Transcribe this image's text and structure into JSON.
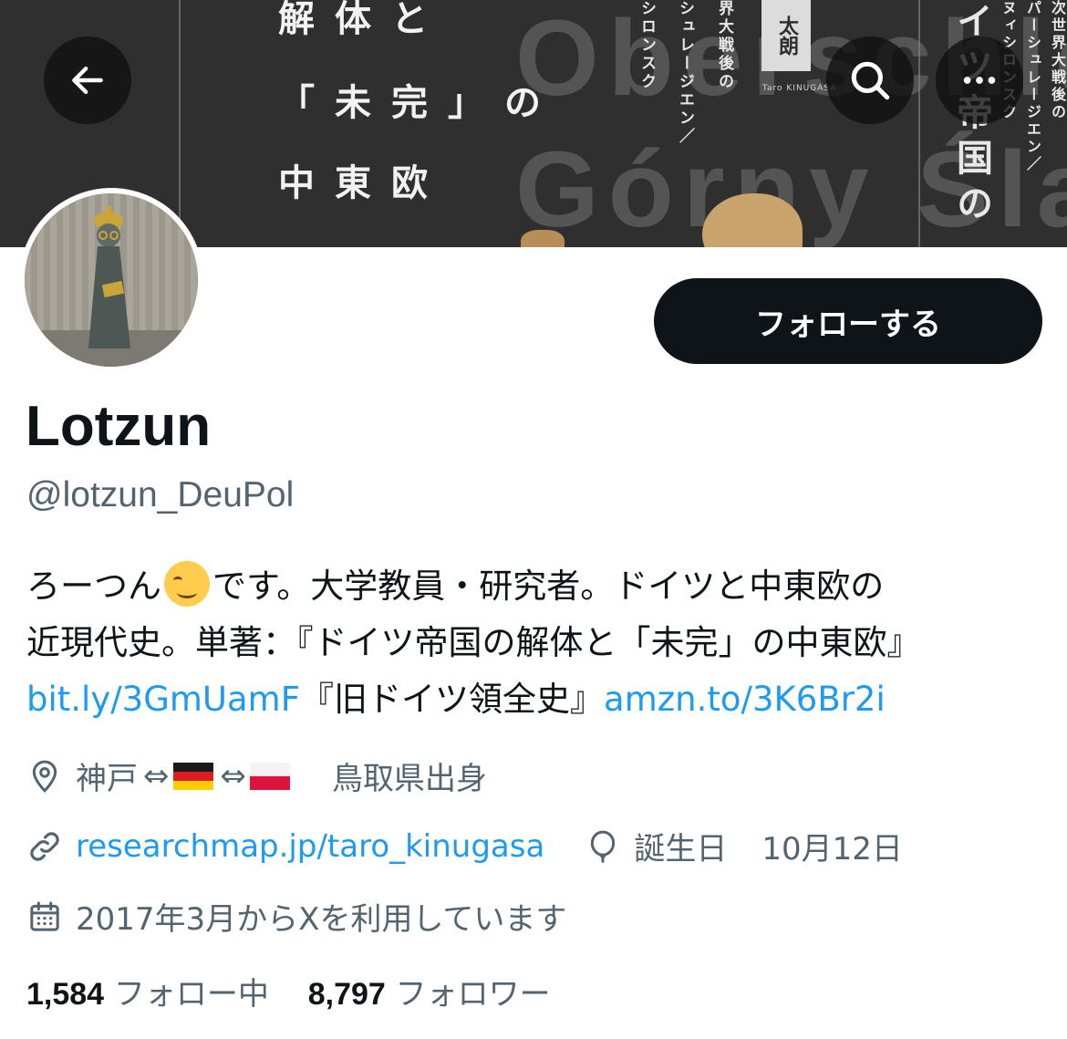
{
  "banner": {
    "title_lines": [
      "解体と",
      "「未完」の",
      "中東欧"
    ],
    "vertical_left": [
      "界大戦後の",
      "シュレージエン／",
      "シロンスク"
    ],
    "author_name": "太朗",
    "author_latin": "Taro KINUGASA",
    "vertical_right_title": [
      "イツ帝国の"
    ],
    "vertical_far_right": [
      "次世界大戦後の",
      "パーシュレージエン／",
      "ヌィシロンスク"
    ],
    "ghost_text": [
      "Oberschles",
      "Górny Śląs"
    ]
  },
  "header": {
    "back_icon": "arrow-left-icon",
    "search_icon": "search-icon",
    "more_icon": "more-horizontal-icon"
  },
  "profile": {
    "display_name": "Lotzun",
    "handle": "@lotzun_DeuPol",
    "follow_label": "フォローする",
    "bio": {
      "line1_before": "ろーつん",
      "line1_after": "です。大学教員・研究者。ドイツと中東欧の",
      "line2": "近現代史。単著：『ドイツ帝国の解体と「未完」の中東欧』",
      "link1": "bit.ly/3GmUamF",
      "line3_mid": "『旧ドイツ領全史』",
      "link2": "amzn.to/3K6Br2i"
    },
    "location": {
      "city": "神戸",
      "arrow1": "⇔",
      "arrow2": "⇔",
      "origin": "鳥取県出身"
    },
    "website": "researchmap.jp/taro_kinugasa",
    "birthday_label": "誕生日",
    "birthday": "10月12日",
    "joined": "2017年3月からXを利用しています",
    "following_count": "1,584",
    "following_label": "フォロー中",
    "followers_count": "8,797",
    "followers_label": "フォロワー"
  },
  "colors": {
    "link": "#1d9bf0",
    "muted": "#536471",
    "text": "#0f1419",
    "button": "#0f1419"
  }
}
